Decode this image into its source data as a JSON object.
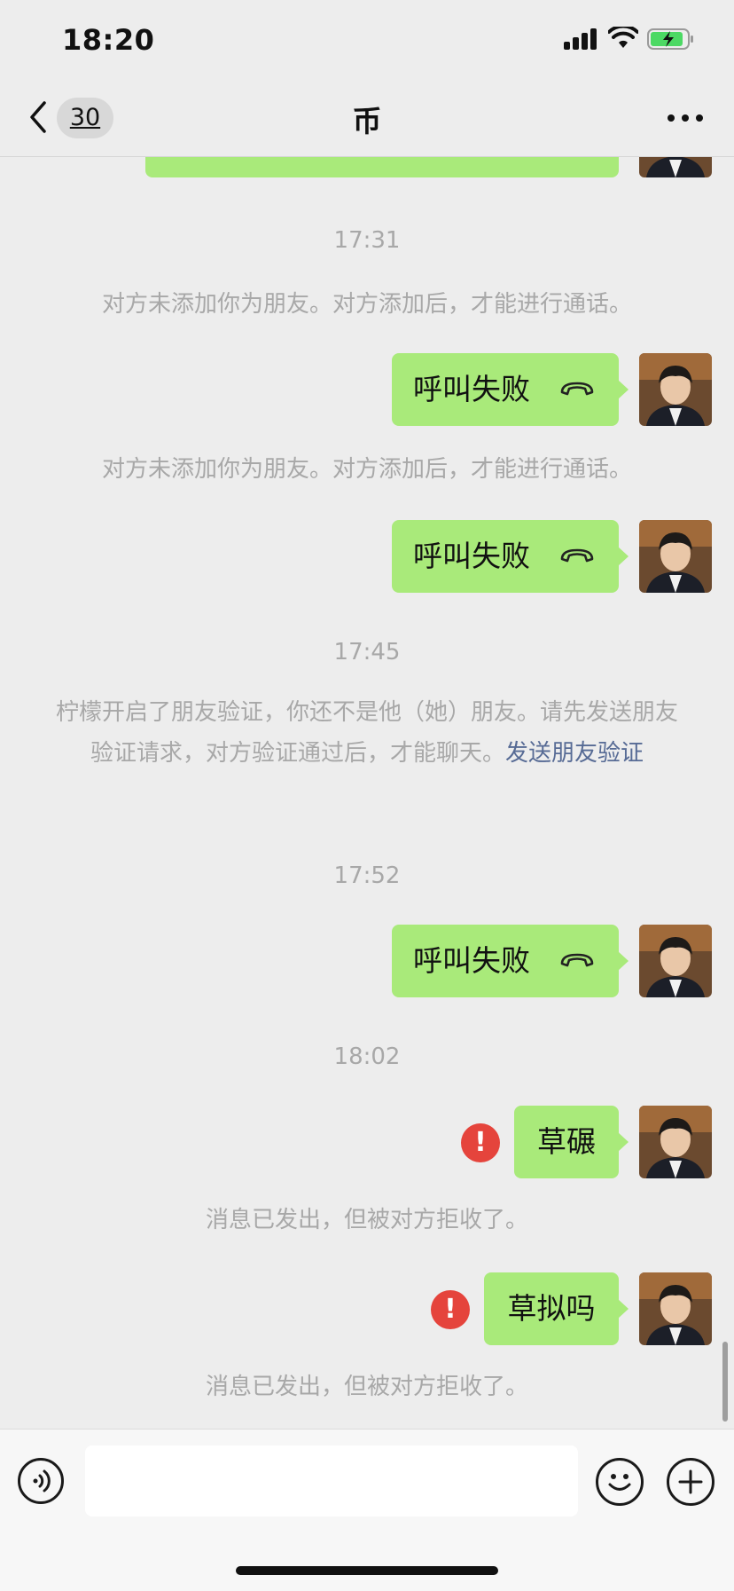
{
  "status_bar": {
    "time": "18:20"
  },
  "header": {
    "unread_count": "30",
    "title": "币"
  },
  "messages": {
    "t1": "17:31",
    "n1": "对方未添加你为朋友。对方添加后，才能进行通话。",
    "call1": "呼叫失败",
    "n2": "对方未添加你为朋友。对方添加后，才能进行通话。",
    "call2": "呼叫失败",
    "t2": "17:45",
    "n3_text": "柠檬开启了朋友验证，你还不是他（她）朋友。请先发送朋友验证请求，对方验证通过后，才能聊天。",
    "n3_link": "发送朋友验证",
    "t3": "17:52",
    "call3": "呼叫失败",
    "t4": "18:02",
    "msg1": "草碾",
    "n4": "消息已发出，但被对方拒收了。",
    "msg2": "草拟吗",
    "n5": "消息已发出，但被对方拒收了。",
    "error_mark": "!"
  },
  "input": {
    "placeholder": ""
  },
  "colors": {
    "bubble_green": "#a9ea7a",
    "background": "#ededed",
    "link_blue": "#576b95",
    "error_red": "#e5443c"
  },
  "icons": [
    "back-chevron-icon",
    "phone-hangup-icon",
    "error-icon",
    "voice-icon",
    "emoji-icon",
    "plus-icon",
    "more-icon",
    "signal-icon",
    "wifi-icon",
    "battery-icon"
  ]
}
